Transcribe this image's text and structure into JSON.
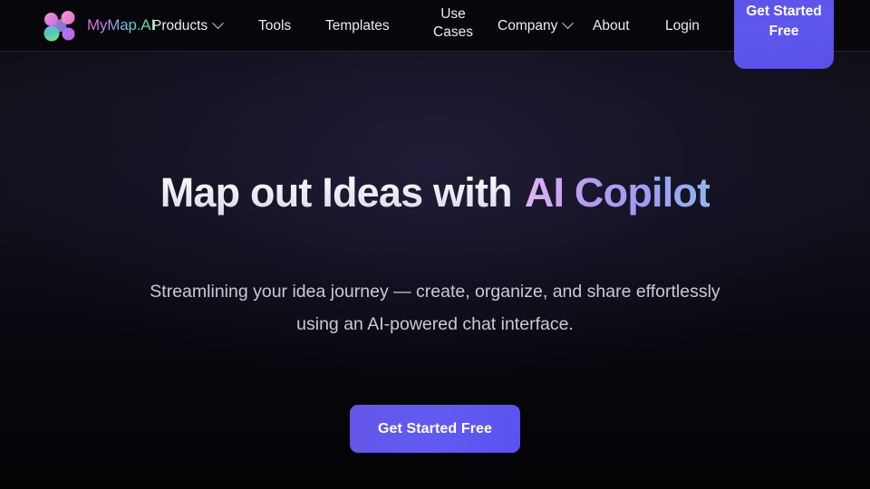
{
  "brand": {
    "name": "MyMap.AI",
    "logo_icon": "cluster-nodes-logo"
  },
  "nav": {
    "items": [
      {
        "label": "Products",
        "has_dropdown": true
      },
      {
        "label": "Tools",
        "has_dropdown": false
      },
      {
        "label": "Templates",
        "has_dropdown": false
      },
      {
        "label": "Use Cases",
        "line1": "Use",
        "line2": "Cases",
        "has_dropdown": false
      },
      {
        "label": "Company",
        "has_dropdown": true
      },
      {
        "label": "About",
        "has_dropdown": false
      },
      {
        "label": "Login",
        "has_dropdown": false
      }
    ],
    "cta_label": "Get Started Free"
  },
  "hero": {
    "headline_plain": "Map out Ideas with",
    "headline_accent": "AI Copilot",
    "subheadline": "Streamlining your idea journey — create, organize, and share effortlessly using an AI-powered chat interface.",
    "cta_label": "Get Started Free"
  },
  "colors": {
    "accent_purple": "#5f56ef",
    "page_background": "#0a0910",
    "header_background": "#07060b",
    "header_border": "#24222e",
    "headline_text": "#ffffff",
    "subheadline_text": "#c9cad6",
    "accent_gradient_start": "#e6b7f5",
    "accent_gradient_end": "#93b6ef"
  }
}
